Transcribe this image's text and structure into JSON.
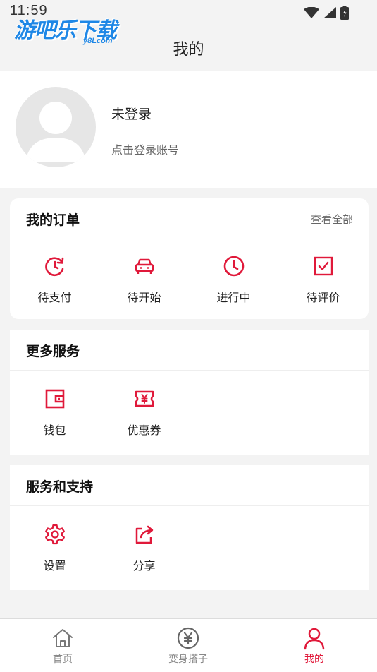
{
  "status_bar": {
    "time": "11:59"
  },
  "watermark": {
    "main": "游吧乐下载",
    "sub": "y8Lcom"
  },
  "header": {
    "title": "我的"
  },
  "profile": {
    "name": "未登录",
    "hint": "点击登录账号"
  },
  "orders": {
    "title": "我的订单",
    "view_all": "查看全部",
    "items": [
      {
        "label": "待支付",
        "icon": "clock-refresh-icon"
      },
      {
        "label": "待开始",
        "icon": "car-icon"
      },
      {
        "label": "进行中",
        "icon": "clock-icon"
      },
      {
        "label": "待评价",
        "icon": "checkbox-icon"
      }
    ]
  },
  "more_services": {
    "title": "更多服务",
    "items": [
      {
        "label": "钱包",
        "icon": "wallet-icon"
      },
      {
        "label": "优惠券",
        "icon": "coupon-icon"
      }
    ]
  },
  "support": {
    "title": "服务和支持",
    "items": [
      {
        "label": "设置",
        "icon": "gear-icon"
      },
      {
        "label": "分享",
        "icon": "share-icon"
      }
    ]
  },
  "tabbar": {
    "items": [
      {
        "label": "首页",
        "icon": "home-icon",
        "active": false
      },
      {
        "label": "变身搭子",
        "icon": "yuan-circle-icon",
        "active": false
      },
      {
        "label": "我的",
        "icon": "person-icon",
        "active": true
      }
    ]
  },
  "colors": {
    "accent": "#e0193a",
    "background": "#f3f3f3",
    "card": "#ffffff"
  }
}
